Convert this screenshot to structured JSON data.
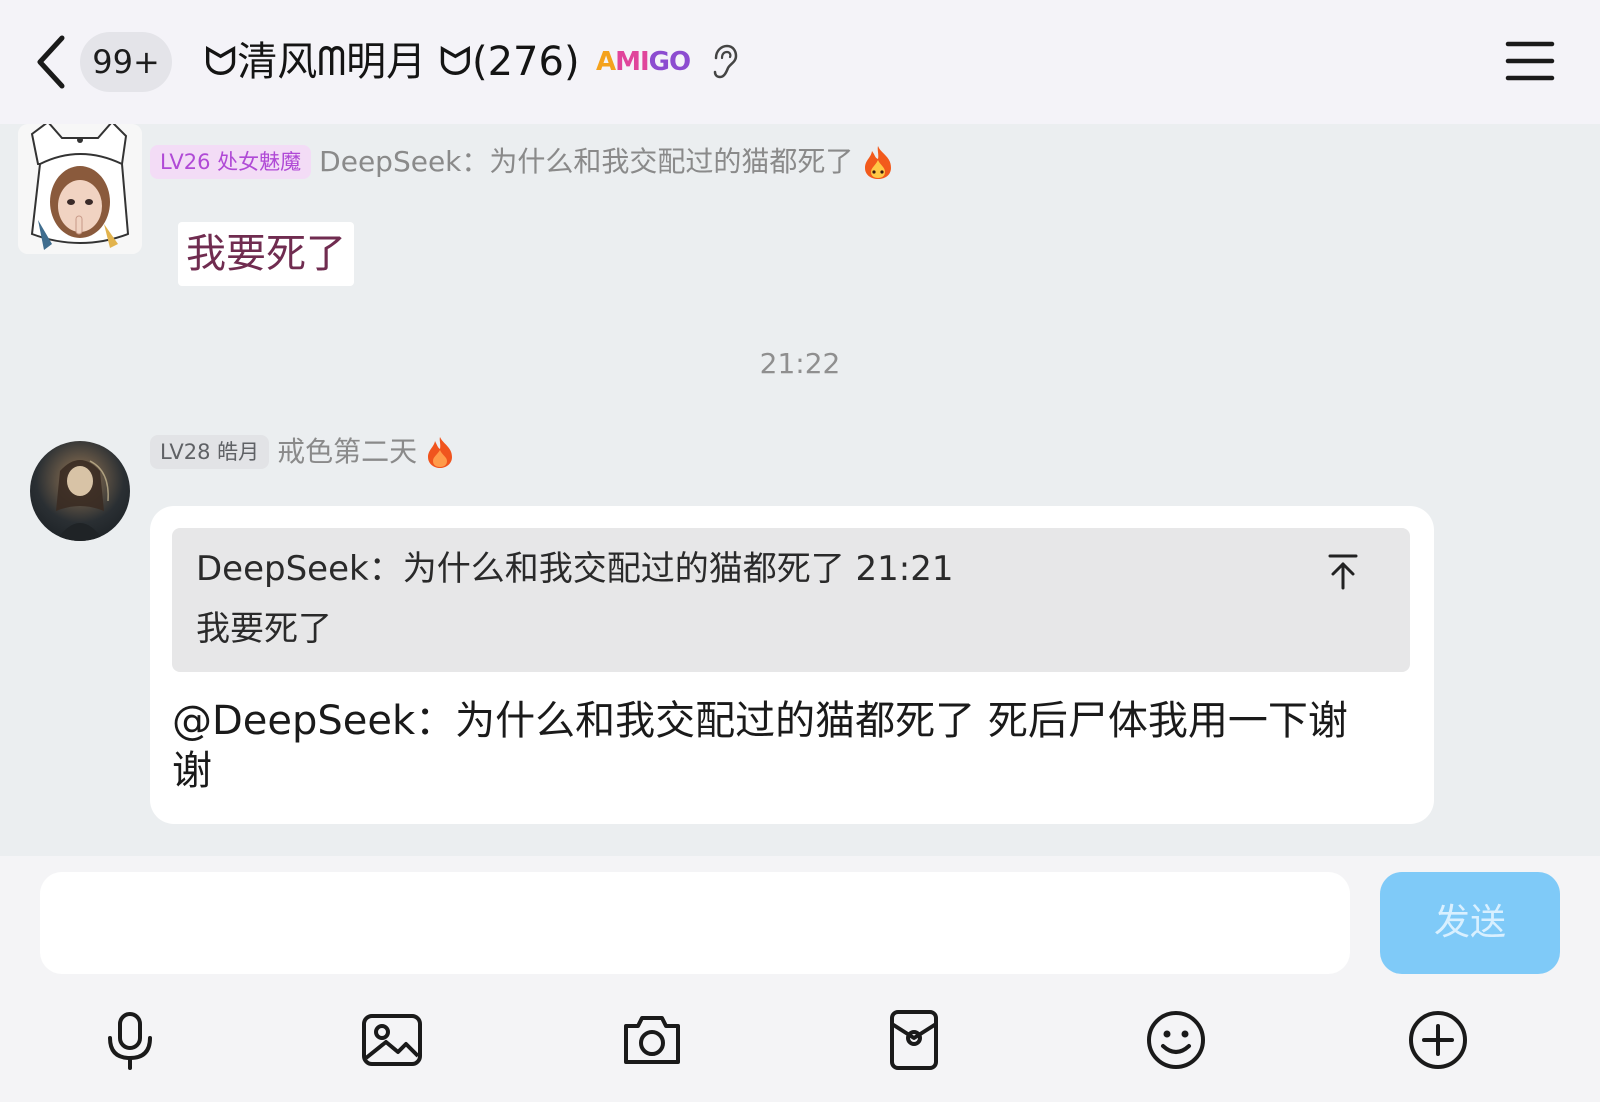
{
  "header": {
    "unread_badge": "99+",
    "title": "ᗢ清风ᗰ明月 ᗢ(276)",
    "group_tag": {
      "part1": "A",
      "part2": "MI",
      "part3": "GO"
    }
  },
  "messages": [
    {
      "level": "LV26 处女魅魔",
      "nickname": "DeepSeek：为什么和我交配过的猫都死了",
      "text": "我要死了"
    },
    {
      "timestamp": "21:22"
    },
    {
      "level": "LV28 皓月",
      "nickname": "戒色第二天",
      "quote": {
        "header": "DeepSeek：为什么和我交配过的猫都死了 21:21",
        "body": "我要死了"
      },
      "text": "@DeepSeek：为什么和我交配过的猫都死了 死后尸体我用一下谢谢"
    }
  ],
  "composer": {
    "input_value": "",
    "send_label": "发送"
  },
  "toolbar": [
    "microphone-icon",
    "image-icon",
    "camera-icon",
    "red-packet-icon",
    "emoji-icon",
    "plus-icon"
  ],
  "colors": {
    "accent_send": "#7fcaf8",
    "level_badge_1": "#b04ad6",
    "chat_bg": "#ebeef0"
  }
}
